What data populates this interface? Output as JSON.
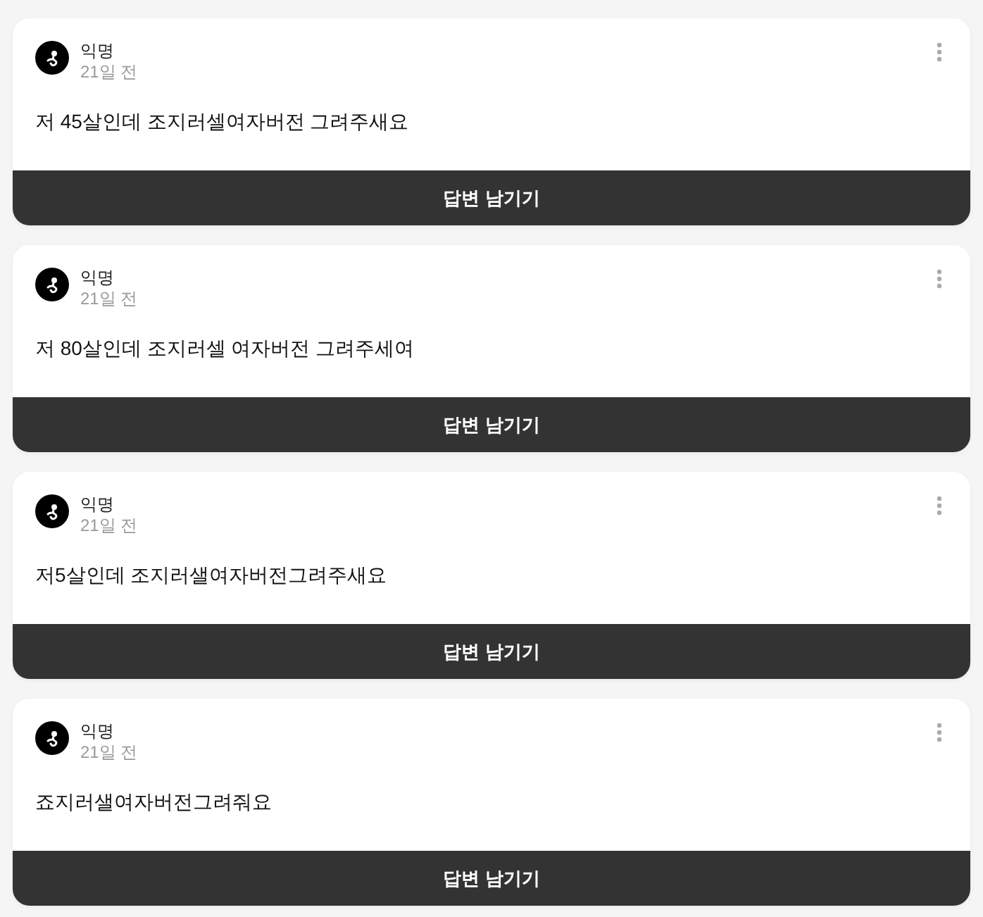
{
  "posts": [
    {
      "author": "익명",
      "time": "21일 전",
      "text": "저 45살인데 조지러셀여자버전 그려주새요",
      "reply_button": "답변 남기기"
    },
    {
      "author": "익명",
      "time": "21일 전",
      "text": "저 80살인데 조지러셀 여자버전 그려주세여",
      "reply_button": "답변 남기기"
    },
    {
      "author": "익명",
      "time": "21일 전",
      "text": "저5살인데 조지러샐여자버전그려주새요",
      "reply_button": "답변 남기기"
    },
    {
      "author": "익명",
      "time": "21일 전",
      "text": "죠지러샐여자버전그려줘요",
      "reply_button": "답변 남기기"
    }
  ]
}
